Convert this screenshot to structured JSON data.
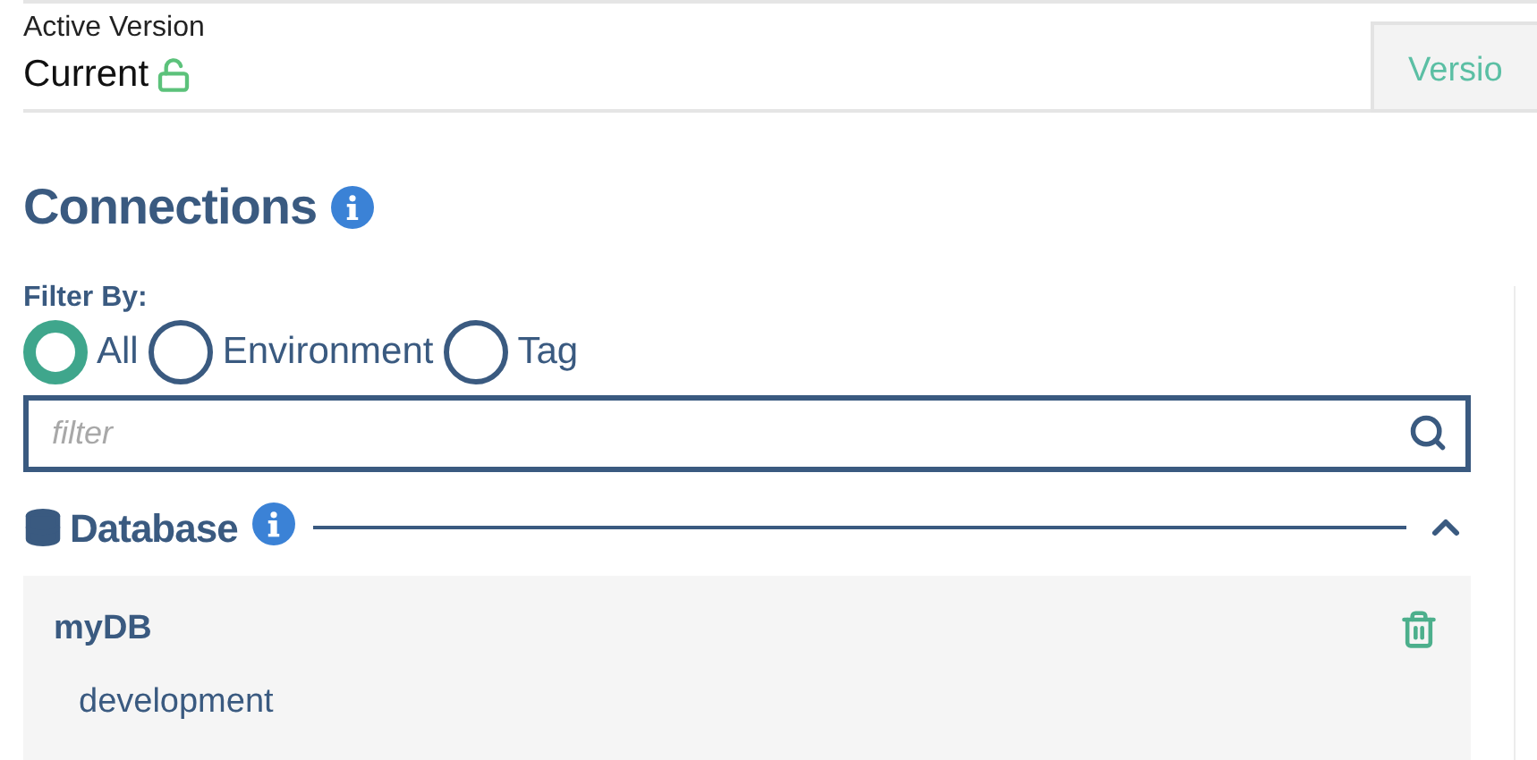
{
  "active_version": {
    "label": "Active Version",
    "value": "Current",
    "locked": false
  },
  "version_tab": {
    "label": "Versio"
  },
  "connections": {
    "title": "Connections"
  },
  "filter": {
    "label": "Filter By:",
    "options": [
      {
        "label": "All",
        "selected": true
      },
      {
        "label": "Environment",
        "selected": false
      },
      {
        "label": "Tag",
        "selected": false
      }
    ],
    "placeholder": "filter"
  },
  "sections": [
    {
      "title": "Database",
      "expanded": true,
      "items": [
        {
          "name": "myDB",
          "environment": "development"
        }
      ]
    }
  ]
}
